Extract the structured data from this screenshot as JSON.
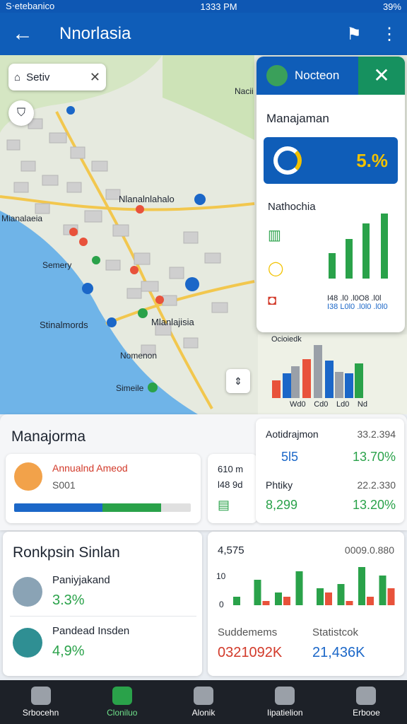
{
  "status": {
    "carrier": "S‧etebanico",
    "time": "1333 PM",
    "battery": "39%"
  },
  "appbar": {
    "title": "Nnorlasia"
  },
  "map": {
    "search": "Setiv",
    "top_label": "Nacii",
    "labels": [
      "Nlanalnlahalo",
      "Mianalaeia",
      "Semery",
      "Stinalmords",
      "Mlanlajisia",
      "Nomenon",
      "Simeile"
    ],
    "chart_caption": "Ocioiedk",
    "axis_labels": [
      "Wd0",
      "Cd0",
      "Ld0",
      "Nd"
    ]
  },
  "panel": {
    "title": "Nocteon",
    "subtitle": "Manajaman",
    "percent": "5.%",
    "section": "Nathochia",
    "footer1": "I48 .l0 .l0O8 .l0l",
    "footer2": "I38 L0l0 .l0l0 .l0l0"
  },
  "card_main": {
    "title": "Manajorma",
    "item_title": "Annualnd Ameod",
    "item_value": "S001",
    "progress": [
      0.46,
      0.73,
      0.85
    ],
    "side1": "610 m",
    "side2": "l48 9d"
  },
  "card_right": {
    "row1_label": "Aotidrajmon",
    "row1_val": "33.2.394",
    "row1_sub": "5l5",
    "row1_pct": "13.70%",
    "row2_label": "Phtiky",
    "row2_val": "22.2.330",
    "row2_sub": "8,299",
    "row2_pct": "13.20%"
  },
  "card_rank": {
    "title": "Ronkpsin Sinlan",
    "item1": "Paniyjakand",
    "item1_pct": "3.3%",
    "item2": "Pandead Insden",
    "item2_pct": "4,9%"
  },
  "card_chart": {
    "left_top": "4,575",
    "right_top": "0009.0.880",
    "tick1": "10",
    "tick0": "0",
    "stat1_label": "Suddemems",
    "stat1_val": "0321092K",
    "stat2_label": "Statistcok",
    "stat2_val": "21,436K"
  },
  "chart_data": {
    "type": "bar",
    "series": [
      {
        "values": [
          2,
          6,
          3,
          8,
          4,
          5,
          9,
          7
        ]
      },
      {
        "values": [
          0,
          1,
          2,
          0,
          3,
          1,
          2,
          4
        ]
      }
    ]
  },
  "nav": [
    {
      "label": "Srbocehn",
      "active": false
    },
    {
      "label": "Cloniluo",
      "active": true
    },
    {
      "label": "Alonik",
      "active": false
    },
    {
      "label": "Iipatielion",
      "active": false
    },
    {
      "label": "Erbooe",
      "active": false
    }
  ]
}
